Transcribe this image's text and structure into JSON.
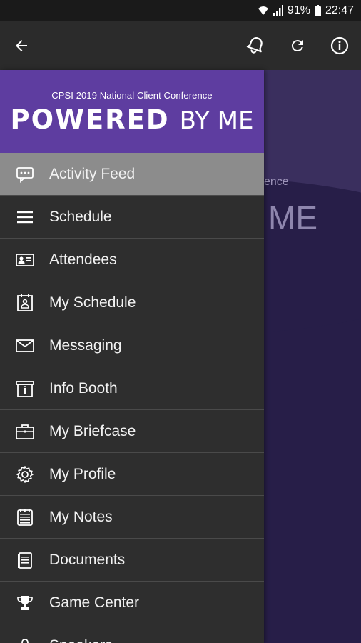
{
  "status_bar": {
    "battery": "91%",
    "time": "22:47"
  },
  "app_bar": {
    "back_icon": "arrow-left-icon",
    "actions": [
      "bell-icon",
      "refresh-icon",
      "info-icon"
    ]
  },
  "background": {
    "small_text": "ence",
    "large_text": "ME"
  },
  "drawer": {
    "banner": {
      "conference": "CPSI 2019 National Client Conference",
      "headline_strong": "POWERED",
      "headline_light": "BY ME"
    },
    "items": [
      {
        "label": "Activity Feed",
        "icon": "activity-feed-icon",
        "active": true
      },
      {
        "label": "Schedule",
        "icon": "schedule-icon"
      },
      {
        "label": "Attendees",
        "icon": "attendees-icon"
      },
      {
        "label": "My Schedule",
        "icon": "my-schedule-icon"
      },
      {
        "label": "Messaging",
        "icon": "envelope-icon"
      },
      {
        "label": "Info Booth",
        "icon": "info-booth-icon"
      },
      {
        "label": "My Briefcase",
        "icon": "briefcase-icon"
      },
      {
        "label": "My Profile",
        "icon": "gear-icon"
      },
      {
        "label": "My Notes",
        "icon": "notes-icon"
      },
      {
        "label": "Documents",
        "icon": "documents-icon"
      },
      {
        "label": "Game Center",
        "icon": "trophy-icon"
      },
      {
        "label": "Speakers",
        "icon": "speaker-icon"
      }
    ]
  },
  "colors": {
    "banner": "#5e3da0",
    "drawer": "#2e2e2e",
    "active_item": "#8c8c8c",
    "background": "#271e48"
  }
}
